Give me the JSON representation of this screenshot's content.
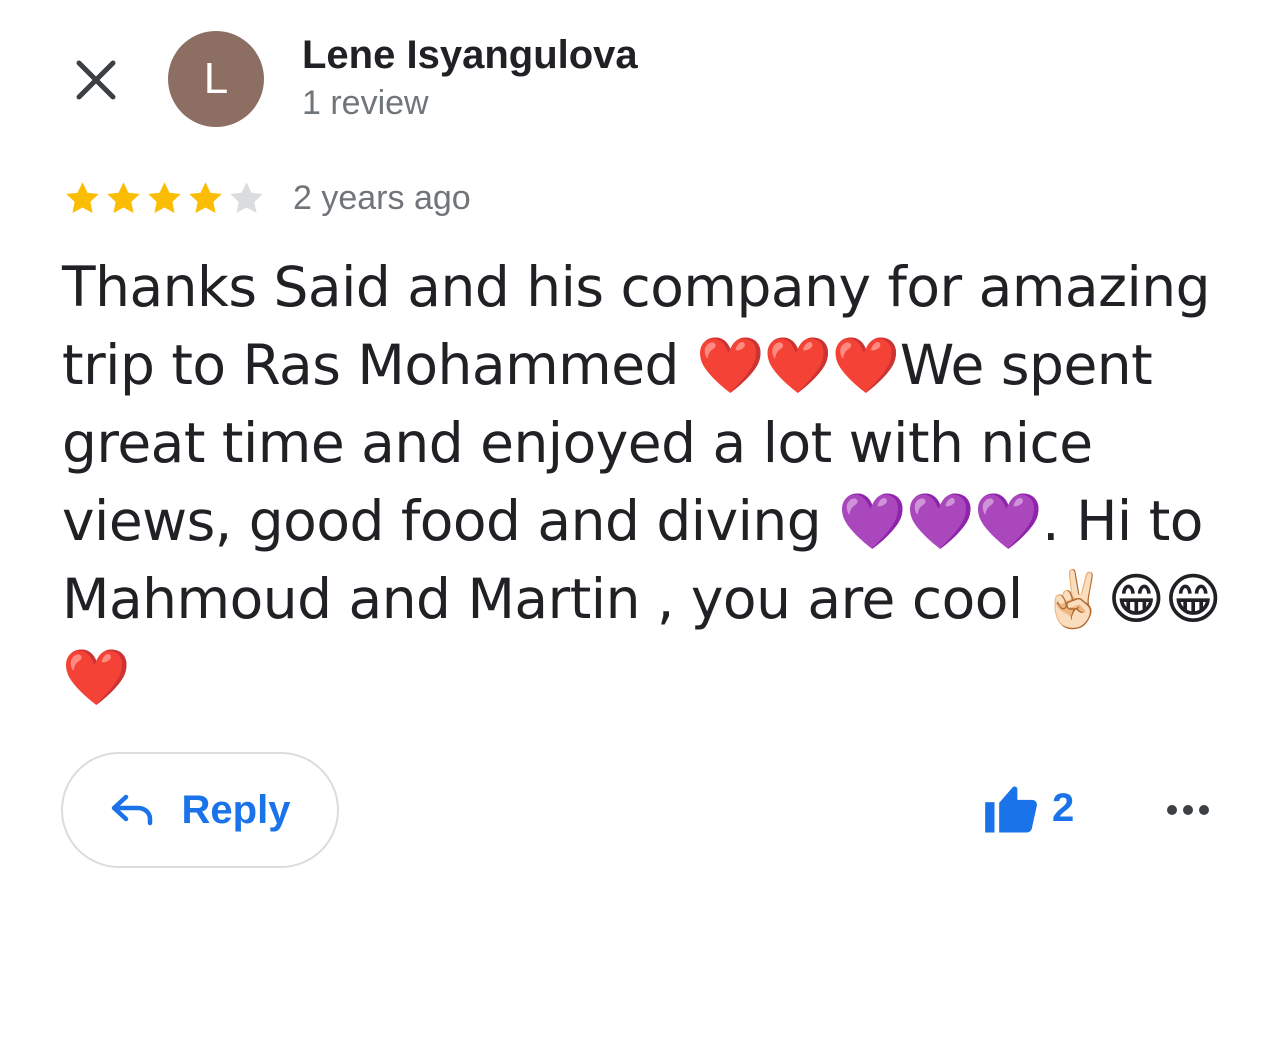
{
  "author": {
    "initial": "L",
    "name": "Lene Isyangulova",
    "review_count_label": "1 review",
    "avatar_color": "#8d6e63"
  },
  "review": {
    "rating": 4,
    "max_rating": 5,
    "timestamp": "2 years ago",
    "text": "Thanks Said and his company for amazing trip to Ras Mohammed ❤️❤️❤️We spent great time and enjoyed a lot with nice views, good food and diving 💜💜💜. Hi to Mahmoud and Martin , you are cool ✌🏻😁😁❤️"
  },
  "actions": {
    "reply_label": "Reply",
    "like_count": "2"
  },
  "icons": {
    "close": "close-icon",
    "reply": "reply-arrow-icon",
    "like": "thumbs-up-icon",
    "more": "more-horizontal-icon",
    "star": "star-icon"
  },
  "colors": {
    "star_filled": "#fbbc04",
    "star_empty": "#dadce0",
    "accent": "#1a73e8",
    "secondary_text": "#70757a"
  }
}
